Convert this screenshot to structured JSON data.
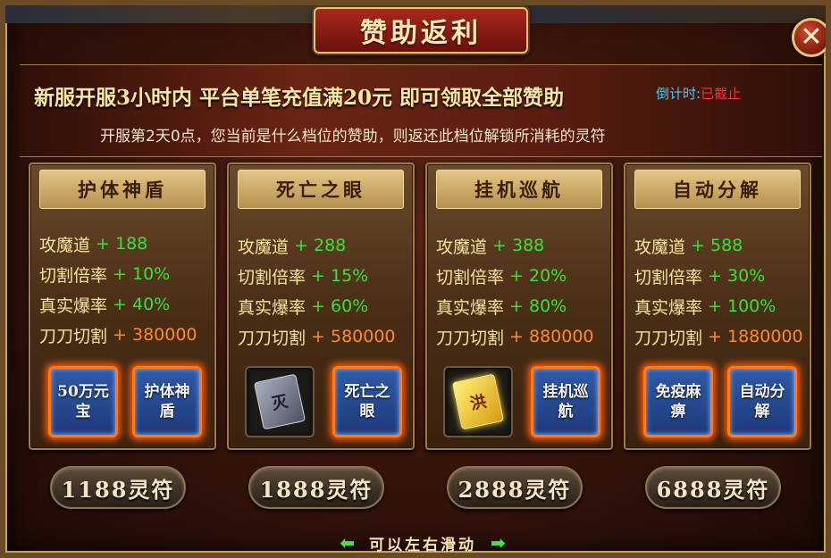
{
  "dialog": {
    "title": "赞助返利",
    "close_label": "✕"
  },
  "banner": {
    "headline": "新服开服3小时内 平台单笔充值满20元 即可领取全部赞助",
    "countdown_label": "倒计时:",
    "countdown_value": "已截止",
    "subline": "开服第2天0点，您当前是什么档位的赞助，则返还此档位解锁所消耗的灵符"
  },
  "tiers": [
    {
      "title": "护体神盾",
      "stats": [
        {
          "name": "攻魔道",
          "value": "+ 188"
        },
        {
          "name": "切割倍率",
          "value": "+ 10%"
        },
        {
          "name": "真实爆率",
          "value": "+ 40%"
        },
        {
          "name": "刀刀切割",
          "value": "+ 380000"
        }
      ],
      "items": [
        "50万元宝",
        "护体神盾"
      ],
      "cost": "1188灵符"
    },
    {
      "title": "死亡之眼",
      "stats": [
        {
          "name": "攻魔道",
          "value": "+ 288"
        },
        {
          "name": "切割倍率",
          "value": "+ 15%"
        },
        {
          "name": "真实爆率",
          "value": "+ 60%"
        },
        {
          "name": "刀刀切割",
          "value": "+ 580000"
        }
      ],
      "items": [
        "灭",
        "死亡之眼"
      ],
      "cost": "1888灵符"
    },
    {
      "title": "挂机巡航",
      "stats": [
        {
          "name": "攻魔道",
          "value": "+ 388"
        },
        {
          "name": "切割倍率",
          "value": "+ 20%"
        },
        {
          "name": "真实爆率",
          "value": "+ 80%"
        },
        {
          "name": "刀刀切割",
          "value": "+ 880000"
        }
      ],
      "items": [
        "洪",
        "挂机巡航"
      ],
      "cost": "2888灵符"
    },
    {
      "title": "自动分解",
      "stats": [
        {
          "name": "攻魔道",
          "value": "+ 588"
        },
        {
          "name": "切割倍率",
          "value": "+ 30%"
        },
        {
          "name": "真实爆率",
          "value": "+ 100%"
        },
        {
          "name": "刀刀切割",
          "value": "+ 1880000"
        }
      ],
      "items": [
        "免疫麻痹",
        "自动分解"
      ],
      "cost": "6888灵符"
    }
  ],
  "footer": {
    "hint": "可以左右滑动",
    "left_arrow": "⬅",
    "right_arrow": "➡"
  },
  "colors": {
    "stat_name": "#f6e49c",
    "stat_value_green": "#3be03b",
    "stat_value_orange": "#ff8a2a",
    "countdown_label": "#3ad1ff",
    "countdown_value": "#ff3030"
  }
}
